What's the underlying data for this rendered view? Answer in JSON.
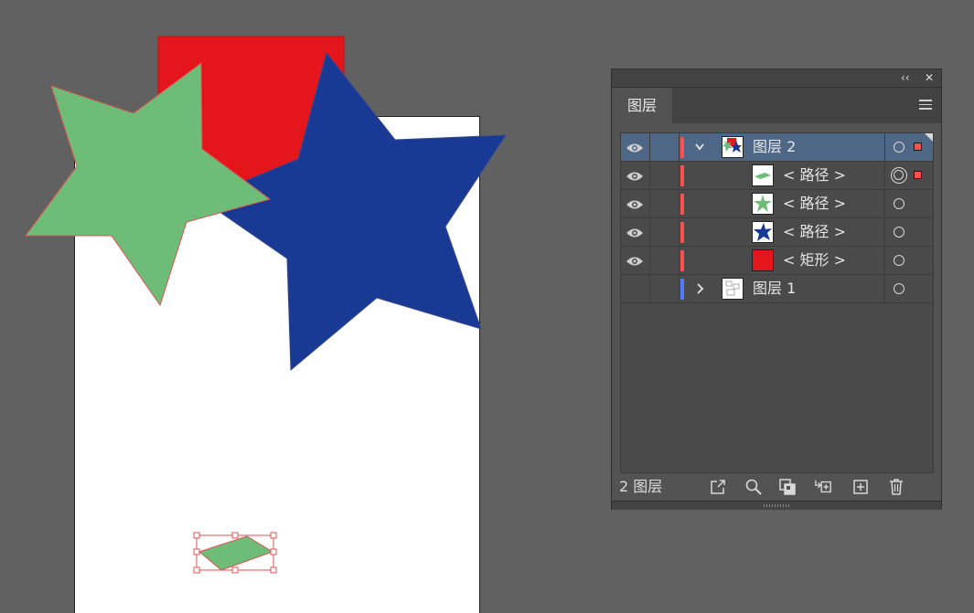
{
  "panel": {
    "collapse_label": "‹‹",
    "close_label": "✕",
    "tab_label": "图层",
    "footer_count": "2 图层"
  },
  "layers": [
    {
      "label": "图层 2",
      "type": "layer",
      "expanded": true,
      "visible": true,
      "selected": true,
      "color": "#ff4e4e",
      "thumb": "layer2"
    },
    {
      "label": "< 路径 >",
      "type": "sublayer",
      "visible": true,
      "color": "#ff4e4e",
      "thumb": "parallelogram",
      "targeted": true
    },
    {
      "label": "< 路径 >",
      "type": "sublayer",
      "visible": true,
      "color": "#ff4e4e",
      "thumb": "green-star"
    },
    {
      "label": "< 路径 >",
      "type": "sublayer",
      "visible": true,
      "color": "#ff4e4e",
      "thumb": "blue-star"
    },
    {
      "label": "< 矩形 >",
      "type": "sublayer",
      "visible": true,
      "color": "#ff4e4e",
      "thumb": "red-rect"
    },
    {
      "label": "图层 1",
      "type": "layer",
      "expanded": false,
      "visible": false,
      "color": "#4f7cff",
      "thumb": "layer1"
    }
  ],
  "colors": {
    "red_shape": "#e5161b",
    "green_shape": "#6dbd79",
    "blue_shape": "#183a95",
    "layer2_color": "#ff4e4e",
    "layer1_color": "#4f7cff",
    "selection_highlight": "#4e6786"
  },
  "footer_icons": [
    "export-icon",
    "locate-icon",
    "clipping-mask-icon",
    "new-sublayer-icon",
    "new-layer-icon",
    "trash-icon"
  ]
}
